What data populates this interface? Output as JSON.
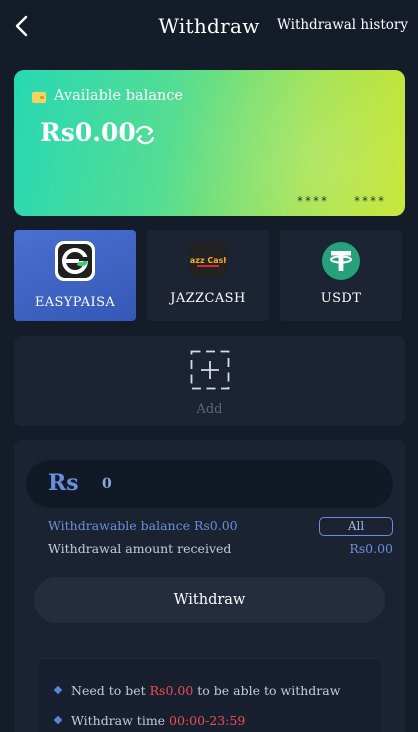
{
  "header": {
    "title": "Withdraw",
    "history_link": "Withdrawal history"
  },
  "balance_card": {
    "label": "Available balance",
    "amount": "Rs0.00",
    "masked_1": "****",
    "masked_2": "****",
    "icons": [
      "wallet-icon",
      "refresh-icon"
    ]
  },
  "methods": [
    {
      "label": "EASYPAISA",
      "icon": "easypaisa-logo",
      "active": true
    },
    {
      "label": "JAZZCASH",
      "icon": "jazzcash-logo",
      "logo_text": "Jazz Cash",
      "active": false
    },
    {
      "label": "USDT",
      "icon": "tether-logo",
      "active": false
    }
  ],
  "add": {
    "label": "Add",
    "icon": "add-icon"
  },
  "form": {
    "currency": "Rs",
    "amount_placeholder": "0",
    "withdrawable_label": "Withdrawable balance Rs0.00",
    "all_button": "All",
    "received_label": "Withdrawal amount received",
    "received_value": "Rs0.00",
    "submit_button": "Withdraw"
  },
  "notes": [
    {
      "before": "Need to bet ",
      "highlight": "Rs0.00",
      "after": " to be able to withdraw"
    },
    {
      "before": "Withdraw time ",
      "highlight": "00:00-23:59",
      "after": ""
    }
  ],
  "colors": {
    "background": "#151c29",
    "accent_blue": "#6a8fd9",
    "highlight_red": "#ee4d4d",
    "card_gradient_start": "#27d8b3",
    "card_gradient_end": "#c7e52f"
  }
}
